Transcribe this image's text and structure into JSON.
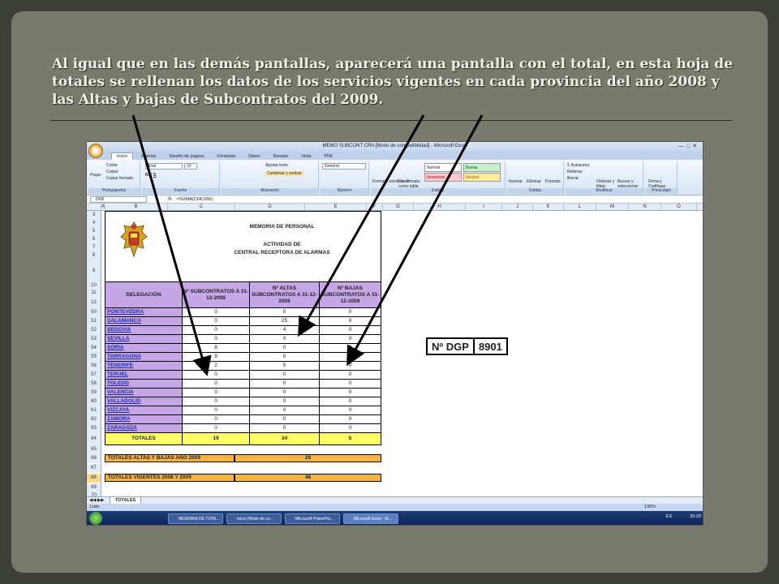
{
  "slide": {
    "headline": "Al igual que en las demás pantallas, aparecerá una pantalla con el total, en esta hoja de totales se rellenan los datos de los servicios vigentes en cada provincia del año 2008 y las Altas y bajas de Subcontratos  del 2009."
  },
  "excel": {
    "window_title": "MEMO SUBCONT CRA  [Modo de compatibilidad] - Microsoft Excel",
    "ribbon_tabs": [
      "Inicio",
      "Insertar",
      "Diseño de página",
      "Fórmulas",
      "Datos",
      "Revisar",
      "Vista",
      "PDF"
    ],
    "ribbon": {
      "portapapeles": {
        "label": "Portapapeles",
        "pegar": "Pegar",
        "cortar": "Cortar",
        "copiar": "Copiar",
        "copiar_formato": "Copiar formato"
      },
      "fuente": {
        "label": "Fuente",
        "font": "Arial",
        "size": "10"
      },
      "alineacion": {
        "label": "Alineación",
        "ajustar": "Ajustar texto",
        "combinar": "Combinar y centrar"
      },
      "numero": {
        "label": "Número",
        "format": "General"
      },
      "estilos": {
        "label": "Estilos",
        "formato_condicional": "Formato condicional",
        "dar_formato": "Dar formato como tabla",
        "normal": "Normal",
        "buena": "Buena",
        "incorrecto": "Incorrecto",
        "neutral": "Neutral"
      },
      "celdas": {
        "label": "Celdas",
        "insertar": "Insertar",
        "eliminar": "Eliminar",
        "formato": "Formato"
      },
      "modificar": {
        "label": "Modificar",
        "autosuma": "Autosuma",
        "rellenar": "Rellenar",
        "borrar": "Borrar",
        "ordenar": "Ordenar y filtrar",
        "buscar": "Buscar y seleccionar"
      },
      "privacidad": {
        "label": "Privacidad",
        "firma": "Firma y Codifique"
      }
    },
    "name_box": "D68",
    "formula": "=SUMA(C64;D66)",
    "columns": [
      "A",
      "B",
      "C",
      "D",
      "E",
      "F",
      "G",
      "H",
      "I",
      "J",
      "K",
      "L",
      "M",
      "N",
      "O"
    ],
    "header_rows": [
      "3",
      "4",
      "5",
      "6",
      "7",
      "8",
      "9",
      "10",
      "11",
      "12"
    ],
    "sheet": {
      "title1": "MEMORIA DE PERSONAL",
      "title2": "ACTIVIDAD DE",
      "title3": "CENTRAL RECEPTORA DE ALARMAS",
      "col_delegacion": "DELEGACIÓN",
      "col_subcontratos": "Nº SUBCONTRATOS A 31-12-2008",
      "col_altas": "Nº ALTAS SUBCONTRATOS A 31-12-2009",
      "col_bajas": "Nº BAJAS SUBCONTRATOS A 31-12-2009",
      "rows": [
        {
          "row": "50",
          "name": "PONTEVEDRA",
          "c": "0",
          "d": "0",
          "e": "0"
        },
        {
          "row": "51",
          "name": "SALAMANCA",
          "c": "0",
          "d": "25",
          "e": "0"
        },
        {
          "row": "52",
          "name": "SEGOVIA",
          "c": "0",
          "d": "4",
          "e": "0"
        },
        {
          "row": "53",
          "name": "SEVILLA",
          "c": "0",
          "d": "0",
          "e": "0"
        },
        {
          "row": "54",
          "name": "SORIA",
          "c": "8",
          "d": "0",
          "e": "0"
        },
        {
          "row": "55",
          "name": "TARRAGONA",
          "c": "9",
          "d": "0",
          "e": "5"
        },
        {
          "row": "56",
          "name": "TENERIFE",
          "c": "2",
          "d": "5",
          "e": "0"
        },
        {
          "row": "57",
          "name": "TERUEL",
          "c": "0",
          "d": "0",
          "e": "0"
        },
        {
          "row": "58",
          "name": "TOLEDO",
          "c": "0",
          "d": "0",
          "e": "0"
        },
        {
          "row": "59",
          "name": "VALENCIA",
          "c": "0",
          "d": "0",
          "e": "0"
        },
        {
          "row": "60",
          "name": "VALLADOLID",
          "c": "0",
          "d": "0",
          "e": "0"
        },
        {
          "row": "61",
          "name": "VIZCAYA",
          "c": "0",
          "d": "0",
          "e": "0"
        },
        {
          "row": "62",
          "name": "ZAMORA",
          "c": "0",
          "d": "0",
          "e": "0"
        },
        {
          "row": "63",
          "name": "ZARAGOZA",
          "c": "0",
          "d": "0",
          "e": "0"
        }
      ],
      "totals": {
        "row": "64",
        "label": "TOTALES",
        "c": "19",
        "d": "34",
        "e": "5"
      },
      "extra_rows": [
        "65",
        "66",
        "67",
        "68",
        "69",
        "70"
      ],
      "altas_bajas_label": "TOTALES ALTAS Y BAJAS AÑO 2009",
      "altas_bajas_value": "29",
      "vigentes_label": "TOTALES VIGENTES 2008 Y 2009",
      "vigentes_value": "48",
      "dgp_label": "Nº DGP",
      "dgp_value": "8901"
    },
    "sheet_tab": "TOTALES",
    "status": "Listo",
    "zoom": "136%",
    "taskbar": [
      "MEMORIA DE TOTA...",
      "Inicio [Modo de co...",
      "Microsoft PowerPoi...",
      "Microsoft Excel - M..."
    ],
    "clock": "20:20",
    "lang": "ES"
  }
}
